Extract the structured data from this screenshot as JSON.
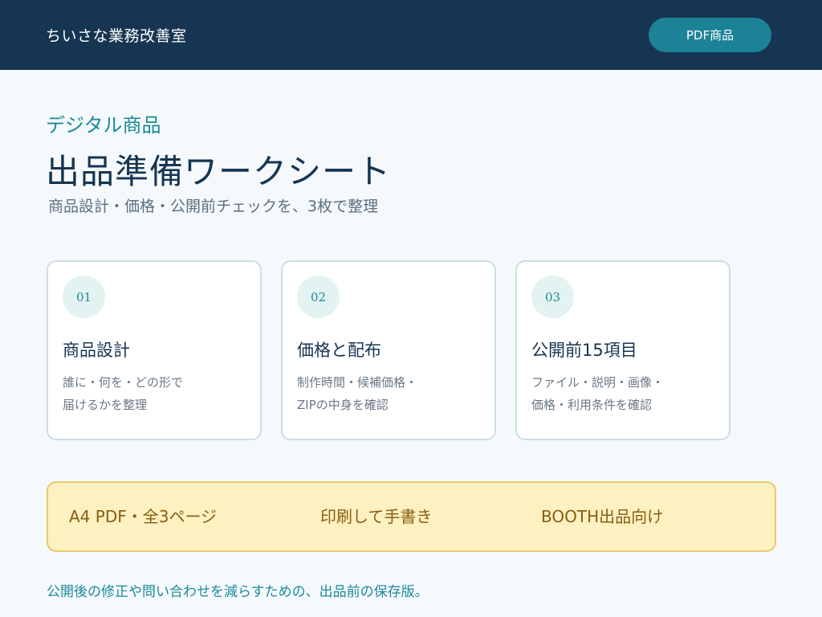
{
  "header": {
    "brand": "ちいさな業務改善室",
    "pdf_button": "PDF商品"
  },
  "hero": {
    "eyebrow": "デジタル商品",
    "title": "出品準備ワークシート",
    "subtitle": "商品設計・価格・公開前チェックを、3枚で整理"
  },
  "cards": [
    {
      "num": "01",
      "title": "商品設計",
      "desc_line1": "誰に・何を・どの形で",
      "desc_line2": "届けるかを整理"
    },
    {
      "num": "02",
      "title": "価格と配布",
      "desc_line1": "制作時間・候補価格・",
      "desc_line2": "ZIPの中身を確認"
    },
    {
      "num": "03",
      "title": "公開前15項目",
      "desc_line1": "ファイル・説明・画像・",
      "desc_line2": "価格・利用条件を確認"
    }
  ],
  "banner": {
    "item1": "A4 PDF・全3ページ",
    "item2": "印刷して手書き",
    "item3": "BOOTH出品向け"
  },
  "footer": {
    "note": "公開後の修正や問い合わせを減らすための、出品前の保存版。"
  },
  "colors": {
    "header_bg": "#163552",
    "accent": "#1c8297",
    "banner_bg": "#fdf0c1"
  }
}
